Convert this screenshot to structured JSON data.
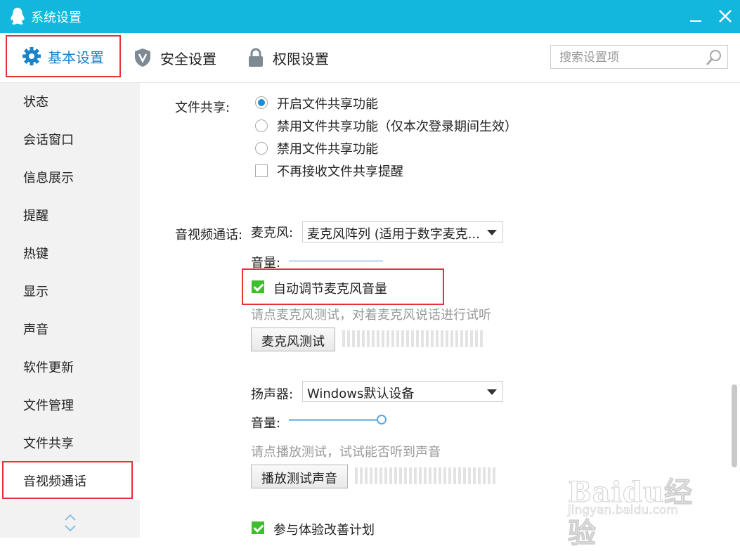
{
  "window": {
    "title": "系统设置"
  },
  "tabs": [
    {
      "label": "基本设置",
      "icon": "gear-icon",
      "active": true
    },
    {
      "label": "安全设置",
      "icon": "shield-icon"
    },
    {
      "label": "权限设置",
      "icon": "lock-icon"
    }
  ],
  "search": {
    "placeholder": "搜索设置项"
  },
  "sidebar": {
    "items": [
      {
        "label": "状态"
      },
      {
        "label": "会话窗口"
      },
      {
        "label": "信息展示"
      },
      {
        "label": "提醒"
      },
      {
        "label": "热键"
      },
      {
        "label": "显示"
      },
      {
        "label": "声音"
      },
      {
        "label": "软件更新"
      },
      {
        "label": "文件管理"
      },
      {
        "label": "文件共享"
      },
      {
        "label": "音视频通话",
        "active": true
      }
    ]
  },
  "file_share": {
    "label": "文件共享:",
    "options": [
      {
        "label": "开启文件共享功能",
        "checked": true
      },
      {
        "label": "禁用文件共享功能（仅本次登录期间生效）",
        "checked": false
      },
      {
        "label": "禁用文件共享功能",
        "checked": false
      }
    ],
    "no_reminder": {
      "label": "不再接收文件共享提醒",
      "checked": false
    }
  },
  "av": {
    "label": "音视频通话:",
    "mic_label": "麦克风:",
    "mic_value": "麦克风阵列 (适用于数字麦克...",
    "volume_label": "音量:",
    "auto_adjust": {
      "label": "自动调节麦克风音量",
      "checked": true
    },
    "mic_hint": "请点麦克风测试，对着麦克风说话进行试听",
    "mic_test_button": "麦克风测试",
    "speaker_label": "扬声器:",
    "speaker_value": "Windows默认设备",
    "speaker_volume_label": "音量:",
    "speaker_volume": 0.9,
    "speaker_hint": "请点播放测试，试试能否听到声音",
    "play_test_button": "播放测试声音",
    "experience": {
      "label": "参与体验改善计划",
      "checked": true
    }
  },
  "watermark": {
    "brand": "Baidu经验",
    "url": "jingyan.baidu.com"
  },
  "colors": {
    "titlebar": "#12b7de",
    "accent": "#1a82c8",
    "highlight": "#e5323a",
    "check": "#3bbf2b"
  }
}
